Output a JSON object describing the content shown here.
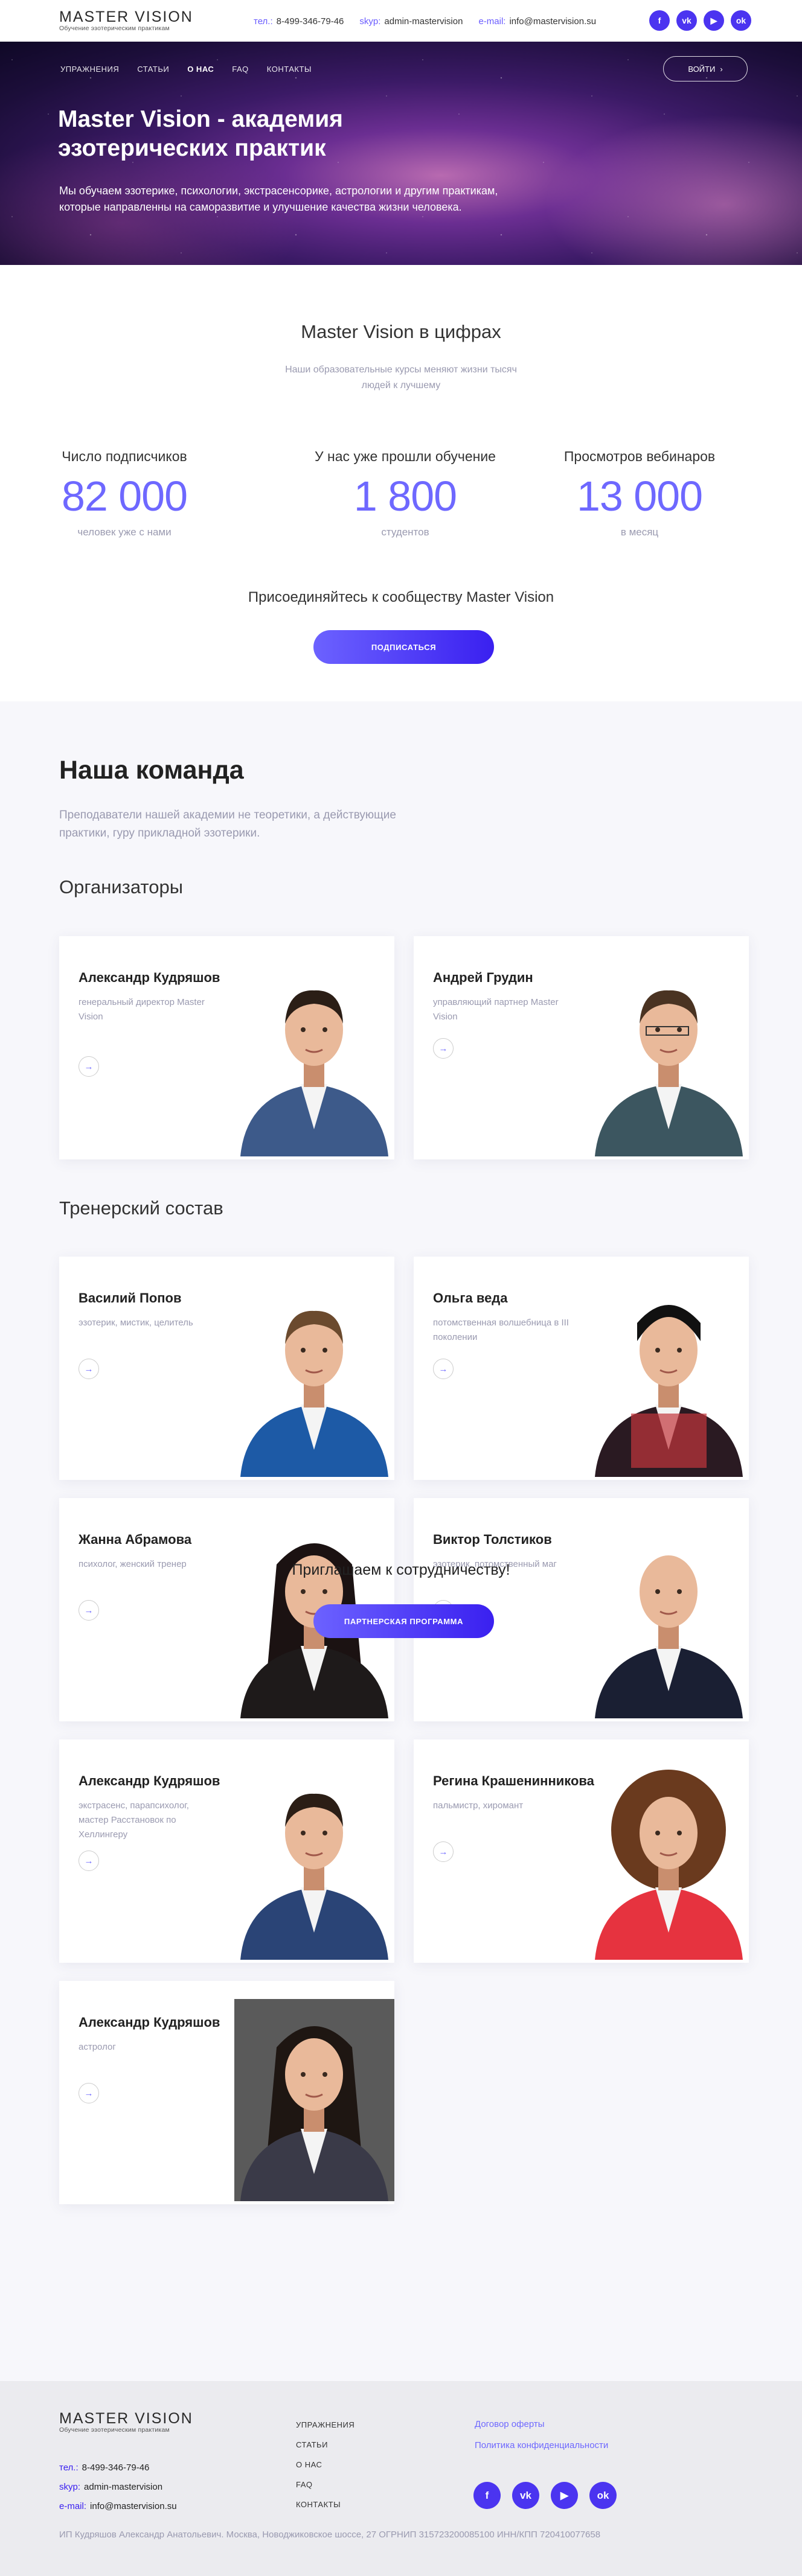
{
  "header": {
    "brand": "Master Vision",
    "tagline": "Обучение эзотерическим практикам",
    "phone_label": "тел.:",
    "phone": "8-499-346-79-46",
    "skype_label": "skyp:",
    "skype": "admin-mastervision",
    "email_label": "e-mail:",
    "email": "info@mastervision.su",
    "socials": [
      {
        "icon": "facebook-icon",
        "glyph": "f"
      },
      {
        "icon": "vk-icon",
        "glyph": "vk"
      },
      {
        "icon": "youtube-icon",
        "glyph": "▶"
      },
      {
        "icon": "odnoklassniki-icon",
        "glyph": "ok"
      }
    ]
  },
  "nav": {
    "items": [
      "УПРАЖНЕНИЯ",
      "СТАТЬИ",
      "О НАС",
      "FAQ",
      "КОНТАКТЫ"
    ],
    "active": "О НАС",
    "login": "ВОЙТИ"
  },
  "hero": {
    "title": "Master Vision - академия эзотерических практик",
    "text": "Мы обучаем эзотерике, психологии, экстрасенсорике, астрологии и другим практикам, которые направленны на саморазвитие и улучшение качества жизни человека."
  },
  "stats": {
    "title": "Master Vision в цифрах",
    "subtitle": "Наши образовательные курсы меняют жизни тысяч людей к лучшему",
    "items": [
      {
        "label": "Число подписчиков",
        "value": "82 000",
        "caption": "человек уже с нами"
      },
      {
        "label": "У нас уже прошли обучение",
        "value": "1 800",
        "caption": "студентов"
      },
      {
        "label": "Просмотров вебинаров",
        "value": "13 000",
        "caption": "в месяц"
      }
    ],
    "join": "Присоединяйтесь к сообществу Master Vision",
    "subscribe": "ПОДПИСАТЬСЯ"
  },
  "team": {
    "title": "Наша команда",
    "lead": "Преподаватели нашей академии не теоретики, а действующие практики, гуру прикладной эзотерики.",
    "organizers_title": "Организаторы",
    "trainers_title": "Тренерский состав",
    "organizers": [
      {
        "name": "Александр Кудряшов",
        "role": "генеральный директор Master Vision",
        "arrow": "→"
      },
      {
        "name": "Андрей Грудин",
        "role": "управляющий партнер Master Vision",
        "arrow": "→"
      }
    ],
    "trainers": [
      {
        "name": "Василий Попов",
        "role": "эзотерик, мистик, целитель",
        "arrow": "→"
      },
      {
        "name": "Ольга веда",
        "role": "потомственная волшебница в III поколении",
        "arrow": "→"
      },
      {
        "name": "Жанна Абрамова",
        "role": "психолог, женский тренер",
        "arrow": "→"
      },
      {
        "name": "Виктор Толстиков",
        "role": "эзотерик, потомственный маг",
        "arrow": "→"
      },
      {
        "name": "Александр Кудряшов",
        "role": "экстрасенс, парапсихолог, мастер Расстановок по Хеллингеру",
        "arrow": "→"
      },
      {
        "name": "Регина Крашенинникова",
        "role": "пальмистр, хиромант",
        "arrow": "→"
      },
      {
        "name": "Александр Кудряшов",
        "role": "астролог",
        "arrow": "→"
      }
    ],
    "coop": "Приглашаем к сотрудничеству!",
    "partner": "ПАРТНЕРСКАЯ ПРОГРАММА"
  },
  "footer": {
    "nav": [
      "УПРАЖНЕНИЯ",
      "СТАТЬИ",
      "О НАС",
      "FAQ",
      "КОНТАКТЫ"
    ],
    "docs": [
      "Договор оферты",
      "Политика конфиденциальности"
    ],
    "legal": "ИП Кудряшов Александр Анатольевич. Москва, Новоджиковское шоссе, 27 ОГРНИП 315723200085100 ИНН/КПП 720410077658"
  }
}
